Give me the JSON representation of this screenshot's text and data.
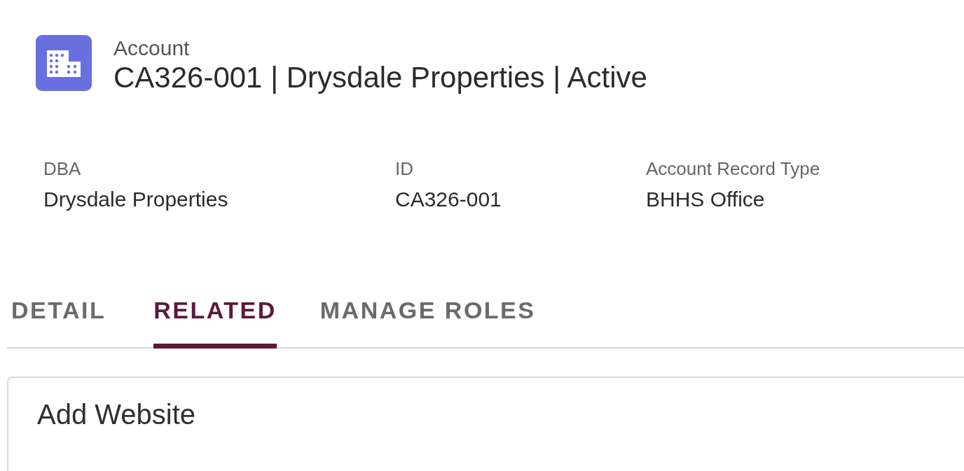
{
  "header": {
    "object_type": "Account",
    "title": "CA326-001 | Drysdale Properties | Active"
  },
  "fields": [
    {
      "label": "DBA",
      "value": "Drysdale Properties"
    },
    {
      "label": "ID",
      "value": "CA326-001"
    },
    {
      "label": "Account Record Type",
      "value": "BHHS Office"
    }
  ],
  "tabs": [
    {
      "label": "DETAIL",
      "selected": false
    },
    {
      "label": "RELATED",
      "selected": true
    },
    {
      "label": "MANAGE ROLES",
      "selected": false
    }
  ],
  "card": {
    "title": "Add Website"
  }
}
